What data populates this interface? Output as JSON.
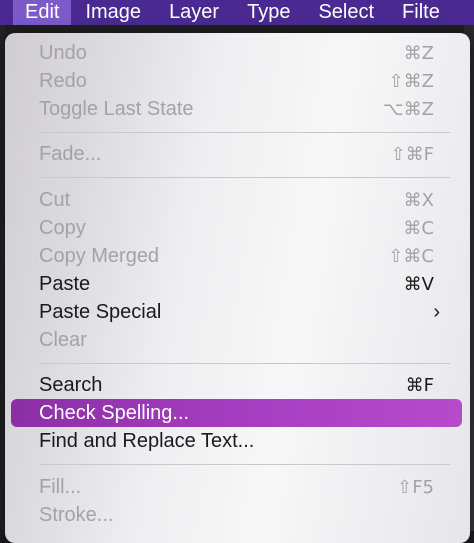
{
  "menubar": {
    "items": [
      "Edit",
      "Image",
      "Layer",
      "Type",
      "Select",
      "Filte"
    ]
  },
  "menu": {
    "undo": {
      "label": "Undo",
      "shortcut": "⌘Z"
    },
    "redo": {
      "label": "Redo",
      "shortcut": "⇧⌘Z"
    },
    "toggle": {
      "label": "Toggle Last State",
      "shortcut": "⌥⌘Z"
    },
    "fade": {
      "label": "Fade...",
      "shortcut": "⇧⌘F"
    },
    "cut": {
      "label": "Cut",
      "shortcut": "⌘X"
    },
    "copy": {
      "label": "Copy",
      "shortcut": "⌘C"
    },
    "copy_merged": {
      "label": "Copy Merged",
      "shortcut": "⇧⌘C"
    },
    "paste": {
      "label": "Paste",
      "shortcut": "⌘V"
    },
    "paste_special": {
      "label": "Paste Special",
      "submenu": "›"
    },
    "clear": {
      "label": "Clear"
    },
    "search": {
      "label": "Search",
      "shortcut": "⌘F"
    },
    "check_spelling": {
      "label": "Check Spelling..."
    },
    "find_replace": {
      "label": "Find and Replace Text..."
    },
    "fill": {
      "label": "Fill...",
      "shortcut": "⇧F5"
    },
    "stroke": {
      "label": "Stroke..."
    }
  },
  "colors": {
    "menubar": "#4a2a92",
    "active_menu": "#7c5ac7",
    "highlight": "#a63dc0"
  }
}
